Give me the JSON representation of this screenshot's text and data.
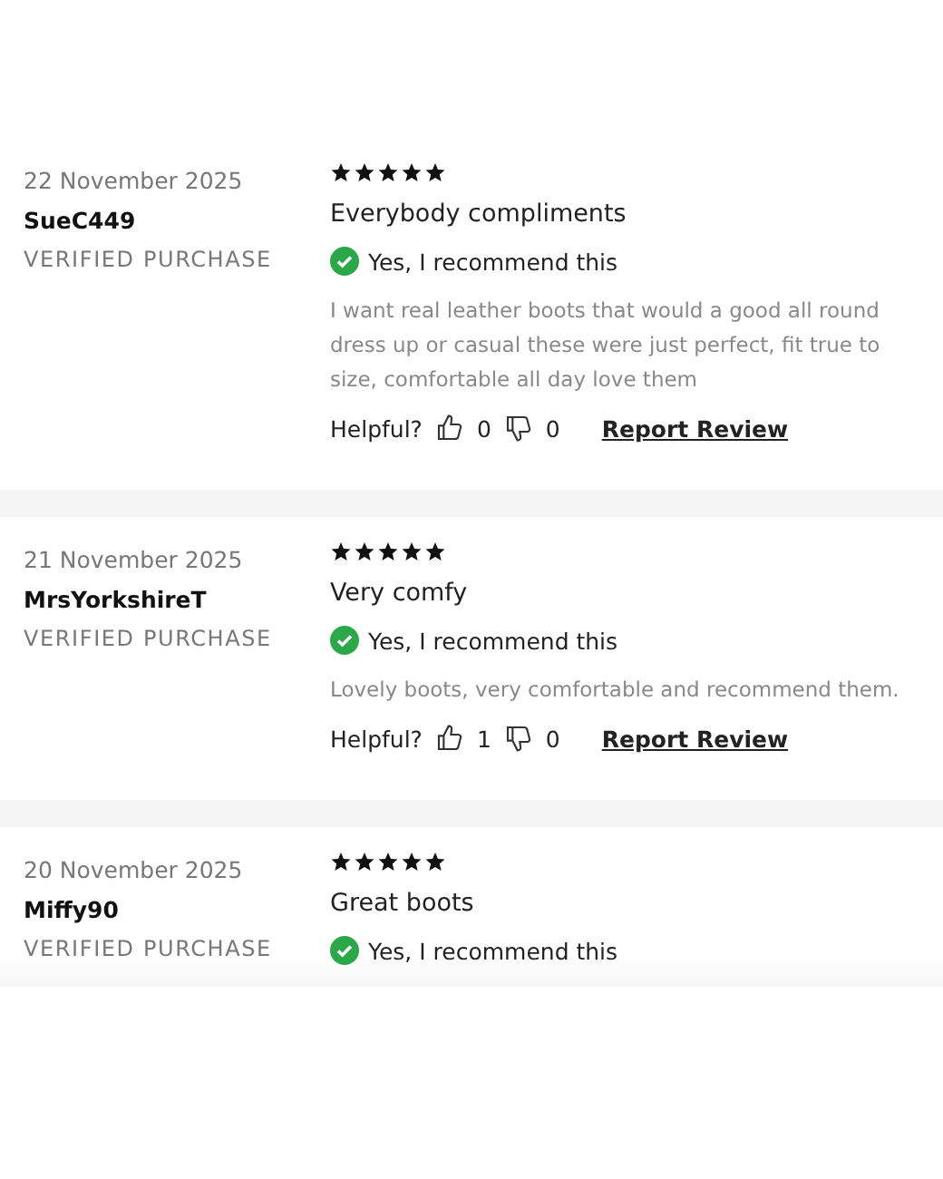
{
  "reviews": [
    {
      "date": "22 November 2025",
      "author": "SueC449",
      "badge": "VERIFIED PURCHASE",
      "stars": 5,
      "title": "Everybody compliments",
      "recommend": "Yes, I recommend this",
      "body": "I want real leather boots that would a good all round dress up or casual these were just perfect, fit true to size, comfortable all day love them",
      "helpful_label": "Helpful?",
      "up_count": "0",
      "down_count": "0",
      "report": "Report Review"
    },
    {
      "date": "21 November 2025",
      "author": "MrsYorkshireT",
      "badge": "VERIFIED PURCHASE",
      "stars": 5,
      "title": "Very comfy",
      "recommend": "Yes, I recommend this",
      "body": "Lovely boots, very comfortable and recommend them.",
      "helpful_label": "Helpful?",
      "up_count": "1",
      "down_count": "0",
      "report": "Report Review"
    },
    {
      "date": "20 November 2025",
      "author": "Miffy90",
      "badge": "VERIFIED PURCHASE",
      "stars": 5,
      "title": "Great boots",
      "recommend": "Yes, I recommend this"
    }
  ]
}
